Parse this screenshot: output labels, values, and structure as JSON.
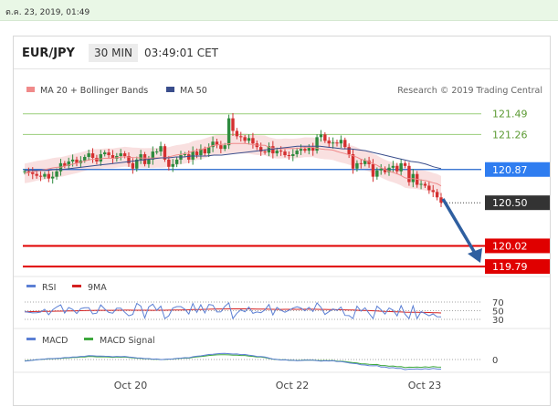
{
  "timestamp": "ต.ค. 23, 2019, 01:49",
  "header": {
    "pair": "EUR/JPY",
    "timeframe": "30 MIN",
    "time": "03:49:01 CET"
  },
  "legend": {
    "ma20": "MA 20 + Bollinger Bands",
    "ma50": "MA 50",
    "credit": "Research © 2019 Trading Central",
    "rsi": "RSI",
    "rsi9": "9MA",
    "macd": "MACD",
    "macd_signal": "MACD Signal"
  },
  "colors": {
    "up": "#2e8b3e",
    "down": "#d43030",
    "support": "#e00000",
    "resistance": "#9acd7a",
    "pivot": "#2266cc",
    "ma50": "#3a4e8c",
    "bands": "#f4c6c6",
    "arrow": "#2f5fa0"
  },
  "chart_data": {
    "type": "line",
    "title": "",
    "x_ticks": [
      "Oct 20",
      "Oct 22",
      "Oct 23"
    ],
    "y_labels": [
      "121.49",
      "121.26",
      "120.87",
      "120.50",
      "120.02",
      "119.79"
    ],
    "levels": [
      {
        "kind": "resistance",
        "value": 121.49
      },
      {
        "kind": "resistance",
        "value": 121.26
      },
      {
        "kind": "pivot",
        "value": 120.87
      },
      {
        "kind": "last",
        "value": 120.5
      },
      {
        "kind": "support",
        "value": 120.02
      },
      {
        "kind": "support",
        "value": 119.79
      }
    ],
    "ylim": [
      119.74,
      121.66
    ],
    "price_series": [
      120.85,
      120.84,
      120.82,
      120.8,
      120.79,
      120.82,
      120.77,
      120.79,
      120.85,
      120.94,
      120.91,
      120.96,
      120.98,
      120.94,
      120.97,
      121.01,
      121.05,
      121.0,
      120.96,
      121.04,
      121.06,
      121.03,
      120.99,
      121.02,
      121.05,
      121.02,
      120.94,
      120.88,
      120.98,
      121.04,
      120.93,
      120.98,
      121.07,
      121.07,
      121.13,
      120.98,
      120.9,
      120.93,
      120.98,
      121.03,
      121.04,
      120.98,
      121.07,
      121.03,
      121.1,
      121.05,
      121.12,
      121.18,
      121.14,
      121.1,
      121.14,
      121.44,
      121.3,
      121.24,
      121.23,
      121.19,
      121.22,
      121.16,
      121.12,
      121.07,
      121.06,
      121.13,
      121.05,
      121.08,
      121.07,
      121.03,
      121.02,
      121.04,
      121.08,
      121.1,
      121.08,
      121.11,
      121.08,
      121.23,
      121.26,
      121.19,
      121.16,
      121.17,
      121.16,
      121.2,
      121.12,
      121.04,
      120.88,
      120.94,
      120.93,
      120.97,
      120.93,
      120.79,
      120.86,
      120.88,
      120.84,
      120.89,
      120.91,
      120.85,
      120.94,
      120.91,
      120.73,
      120.82,
      120.7,
      120.71,
      120.69,
      120.64,
      120.62,
      120.56,
      120.5
    ],
    "ma50_series": [
      120.86,
      120.86,
      120.86,
      120.86,
      120.87,
      120.87,
      120.88,
      120.89,
      120.9,
      120.91,
      120.92,
      120.93,
      120.94,
      120.95,
      120.96,
      120.97,
      120.98,
      120.99,
      121.0,
      121.0,
      121.01,
      121.01,
      121.02,
      121.02,
      121.02,
      121.03,
      121.03,
      121.04,
      121.05,
      121.06,
      121.07,
      121.08,
      121.09,
      121.1,
      121.11,
      121.12,
      121.13,
      121.13,
      121.13,
      121.13,
      121.12,
      121.11,
      121.1,
      121.1,
      121.09,
      121.08,
      121.06,
      121.04,
      121.02,
      121.0,
      120.98,
      120.96,
      120.95,
      120.93,
      120.9,
      120.88
    ],
    "rsi_levels": [
      70,
      50,
      30
    ],
    "macd_zero": 0
  }
}
